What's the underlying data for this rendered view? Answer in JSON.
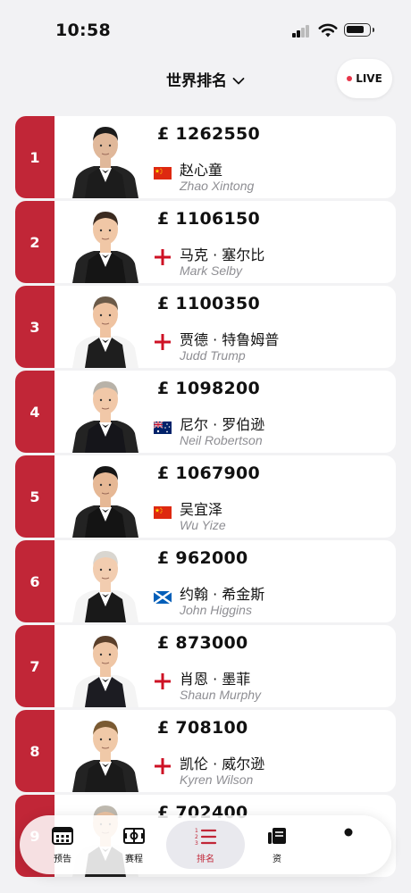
{
  "status_bar": {
    "time": "10:58"
  },
  "header": {
    "title": "世界排名",
    "live_label": "LIVE"
  },
  "rankings": [
    {
      "rank": "1",
      "prize": "£ 1262550",
      "name_cn": "赵心童",
      "name_en": "Zhao Xintong",
      "country": "china"
    },
    {
      "rank": "2",
      "prize": "£ 1106150",
      "name_cn": "马克 · 塞尔比",
      "name_en": "Mark Selby",
      "country": "england"
    },
    {
      "rank": "3",
      "prize": "£ 1100350",
      "name_cn": "贾德 · 特鲁姆普",
      "name_en": "Judd Trump",
      "country": "england"
    },
    {
      "rank": "4",
      "prize": "£ 1098200",
      "name_cn": "尼尔 · 罗伯逊",
      "name_en": "Neil Robertson",
      "country": "australia"
    },
    {
      "rank": "5",
      "prize": "£ 1067900",
      "name_cn": "吴宜泽",
      "name_en": "Wu Yize",
      "country": "china"
    },
    {
      "rank": "6",
      "prize": "£ 962000",
      "name_cn": "约翰 · 希金斯",
      "name_en": "John Higgins",
      "country": "scotland"
    },
    {
      "rank": "7",
      "prize": "£ 873000",
      "name_cn": "肖恩 · 墨菲",
      "name_en": "Shaun Murphy",
      "country": "england"
    },
    {
      "rank": "8",
      "prize": "£ 708100",
      "name_cn": "凯伦 · 威尔逊",
      "name_en": "Kyren Wilson",
      "country": "england"
    },
    {
      "rank": "9",
      "prize": "£ 702400",
      "name_cn": "",
      "name_en": "",
      "country": ""
    }
  ],
  "tabbar": {
    "tabs": [
      {
        "label": "预告",
        "icon": "calendar-icon"
      },
      {
        "label": "赛程",
        "icon": "table-icon"
      },
      {
        "label": "排名",
        "icon": "ranking-list-icon",
        "active": true
      },
      {
        "label": "资",
        "icon": "news-icon"
      },
      {
        "label": "",
        "icon": "profile-icon"
      }
    ]
  },
  "colors": {
    "accent": "#c12637",
    "live_dot": "#e8364a",
    "secondary_text": "#8e8e93",
    "background": "#f2f2f4"
  }
}
